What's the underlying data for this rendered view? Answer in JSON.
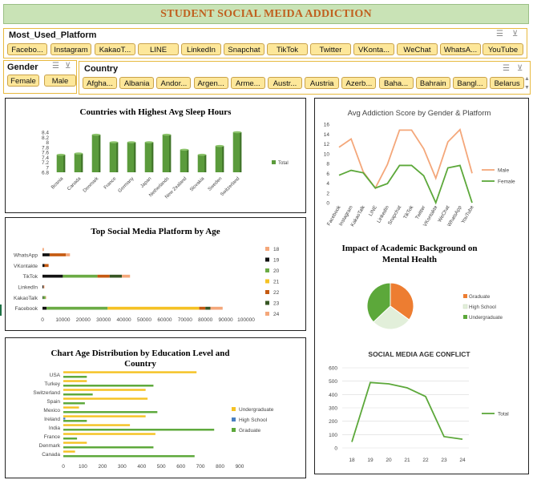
{
  "title": "STUDENT SOCIAL MEIDA ADDICTION",
  "slicers": {
    "platform": {
      "header": "Most_Used_Platform",
      "items": [
        "Facebo...",
        "Instagram",
        "KakaoT...",
        "LINE",
        "LinkedIn",
        "Snapchat",
        "TikTok",
        "Twitter",
        "VKonta...",
        "WeChat",
        "WhatsA...",
        "YouTube"
      ]
    },
    "gender": {
      "header": "Gender",
      "items": [
        "Female",
        "Male"
      ]
    },
    "country": {
      "header": "Country",
      "items": [
        "Afgha...",
        "Albania",
        "Andor...",
        "Argen...",
        "Arme...",
        "Austr...",
        "Austria",
        "Azerb...",
        "Baha...",
        "Bahrain",
        "Bangl...",
        "Belarus"
      ]
    }
  },
  "colors": {
    "title_bg": "#c9e3b6",
    "title_text": "#c0601f",
    "slicer_border": "#e7b93f",
    "chip_fill": "#fde79a",
    "green": "#5b9b3c",
    "male": "#f4a77a",
    "female": "#5ca83a"
  },
  "chart_data": [
    {
      "type": "bar",
      "title": "Countries with Highest Avg Sleep Hours",
      "categories": [
        "Bosnia",
        "Canada",
        "Denmark",
        "France",
        "Germany",
        "Japan",
        "Netherlands",
        "New Zealand",
        "Slovakia",
        "Sweden",
        "Switzerland"
      ],
      "series": [
        {
          "name": "Total",
          "values": [
            7.5,
            7.55,
            8.3,
            8.0,
            8.0,
            8.0,
            8.3,
            7.7,
            7.5,
            7.85,
            8.4
          ]
        }
      ],
      "yticks": [
        "6.8",
        "7",
        "7.2",
        "7.4",
        "7.6",
        "7.8",
        "8",
        "8.2",
        "8.4"
      ],
      "ylim": [
        6.8,
        8.4
      ],
      "legend": "right"
    },
    {
      "type": "bar",
      "orientation": "horizontal",
      "stacked": true,
      "title": "Top Social Media Platform by Age",
      "categories": [
        "Facebook",
        "",
        "KakaoTalk",
        "",
        "LinkedIn",
        "",
        "TikTok",
        "",
        "VKontakte",
        "",
        "WhatsApp",
        ""
      ],
      "series": [
        {
          "name": "18",
          "values": [
            0,
            0,
            0,
            0,
            0,
            0,
            0,
            0,
            0,
            0,
            0,
            700
          ],
          "color": "#f4a77a"
        },
        {
          "name": "19",
          "values": [
            2000,
            0,
            300,
            0,
            500,
            0,
            10000,
            0,
            1000,
            0,
            3500,
            0
          ],
          "color": "#111111"
        },
        {
          "name": "20",
          "values": [
            30000,
            0,
            1200,
            0,
            0,
            0,
            17000,
            0,
            0,
            0,
            0,
            0
          ],
          "color": "#6bab45"
        },
        {
          "name": "21",
          "values": [
            45000,
            0,
            0,
            0,
            0,
            0,
            0,
            0,
            0,
            0,
            0,
            0
          ],
          "color": "#f5c224"
        },
        {
          "name": "22",
          "values": [
            3000,
            0,
            0,
            0,
            0,
            0,
            6000,
            0,
            2000,
            0,
            8000,
            0
          ],
          "color": "#c55a11"
        },
        {
          "name": "23",
          "values": [
            2500,
            0,
            0,
            0,
            0,
            0,
            6000,
            0,
            0,
            0,
            0,
            0
          ],
          "color": "#375623"
        },
        {
          "name": "24",
          "values": [
            6000,
            0,
            300,
            0,
            500,
            0,
            4000,
            0,
            0,
            0,
            2000,
            0
          ],
          "color": "#f4a77a"
        }
      ],
      "xticks": [
        "0",
        "10000",
        "20000",
        "30000",
        "40000",
        "50000",
        "60000",
        "70000",
        "80000",
        "90000",
        "100000"
      ],
      "xlim": [
        0,
        100000
      ],
      "legend": "right"
    },
    {
      "type": "bar",
      "orientation": "horizontal",
      "title": "Chart Age Distribution by Education Level and Country",
      "categories": [
        "Canada",
        "Denmark",
        "France",
        "India",
        "Ireland",
        "Mexico",
        "Spain",
        "Switzerland",
        "Turkey",
        "USA"
      ],
      "series": [
        {
          "name": "Undergraduate",
          "values": [
            60,
            120,
            470,
            340,
            420,
            80,
            430,
            420,
            120,
            680
          ],
          "color": "#f5c224"
        },
        {
          "name": "High School",
          "values": [
            0,
            0,
            0,
            0,
            10,
            0,
            0,
            0,
            0,
            0
          ],
          "color": "#4a7fc1"
        },
        {
          "name": "Graduate",
          "values": [
            670,
            460,
            70,
            770,
            120,
            480,
            110,
            150,
            460,
            120
          ],
          "color": "#5ca83a"
        }
      ],
      "xticks": [
        "0",
        "100",
        "200",
        "300",
        "400",
        "500",
        "600",
        "700",
        "800",
        "900"
      ],
      "xlim": [
        0,
        900
      ],
      "legend": "right"
    },
    {
      "type": "line",
      "title": "Avg Addiction Score by Gender & Platform",
      "categories": [
        "Facebook",
        "Instagram",
        "KakaoTalk",
        "LINE",
        "LinkedIn",
        "Snapchat",
        "TikTok",
        "Twitter",
        "VKontakte",
        "WeChat",
        "WhatsApp",
        "YouTube"
      ],
      "series": [
        {
          "name": "Male",
          "values": [
            11.3,
            13.0,
            6.3,
            3.0,
            7.8,
            14.8,
            14.8,
            11.0,
            5.0,
            12.4,
            14.9,
            6.0
          ],
          "color": "#f4a77a"
        },
        {
          "name": "Female",
          "values": [
            5.6,
            6.6,
            6.1,
            3.0,
            3.9,
            7.6,
            7.6,
            5.5,
            0,
            7.1,
            7.6,
            0
          ],
          "color": "#5ca83a"
        }
      ],
      "yticks": [
        "0",
        "2",
        "4",
        "6",
        "8",
        "10",
        "12",
        "14",
        "16"
      ],
      "ylim": [
        0,
        16
      ],
      "legend": "right"
    },
    {
      "type": "pie",
      "title": "Impact of Academic Background on Mental Health",
      "labels": [
        "Graduate",
        "High School",
        "Undergraduate"
      ],
      "values": [
        35,
        28,
        37
      ],
      "colors": [
        "#ed7d31",
        "#e2efda",
        "#5ca83a"
      ],
      "legend": "right"
    },
    {
      "type": "line",
      "title": "SOCIAL MEDIA AGE CONFLICT",
      "categories": [
        "18",
        "19",
        "20",
        "21",
        "22",
        "23",
        "24"
      ],
      "series": [
        {
          "name": "Total",
          "values": [
            45,
            490,
            480,
            450,
            385,
            85,
            65
          ],
          "color": "#5ca83a"
        }
      ],
      "yticks": [
        "0",
        "100",
        "200",
        "300",
        "400",
        "500",
        "600"
      ],
      "ylim": [
        0,
        600
      ],
      "legend": "right"
    }
  ]
}
